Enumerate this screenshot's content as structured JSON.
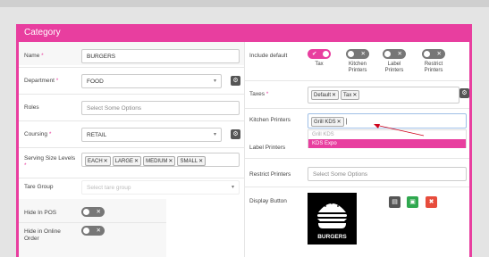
{
  "header": {
    "title": "Category"
  },
  "fields": {
    "name": {
      "label": "Name",
      "value": "BURGERS"
    },
    "department": {
      "label": "Department",
      "value": "FOOD"
    },
    "roles": {
      "label": "Roles",
      "placeholder": "Select Some Options"
    },
    "coursing": {
      "label": "Coursing",
      "value": "RETAIL"
    },
    "serving_size": {
      "label": "Serving Size Levels",
      "tags": [
        "EACH",
        "LARGE",
        "MEDIUM",
        "SMALL"
      ]
    },
    "tare_group": {
      "label": "Tare Group",
      "placeholder": "Select tare group"
    },
    "hide_pos": {
      "label": "Hide In POS"
    },
    "hide_online": {
      "label": "Hide in Online Order"
    }
  },
  "right": {
    "include_default": {
      "label": "Include default",
      "toggles": [
        {
          "label": "Tax",
          "on": true
        },
        {
          "label": "Kitchen Printers",
          "on": false
        },
        {
          "label": "Label Printers",
          "on": false
        },
        {
          "label": "Restrict Printers",
          "on": false
        }
      ]
    },
    "taxes": {
      "label": "Taxes",
      "tags": [
        "Default",
        "Tax"
      ]
    },
    "kitchen_printers": {
      "label": "Kitchen Printers",
      "tags": [
        "Grill KDS"
      ],
      "options": [
        "Grill KDS",
        "KDS Expo"
      ]
    },
    "label_printers": {
      "label": "Label Printers"
    },
    "restrict_printers": {
      "label": "Restrict Printers",
      "placeholder": "Select Some Options"
    },
    "display_button": {
      "label": "Display Button",
      "image_text": "BURGERS"
    }
  },
  "colors": {
    "accent": "#e83e9f",
    "save": "#2fa84f",
    "delete": "#e74c3c"
  }
}
